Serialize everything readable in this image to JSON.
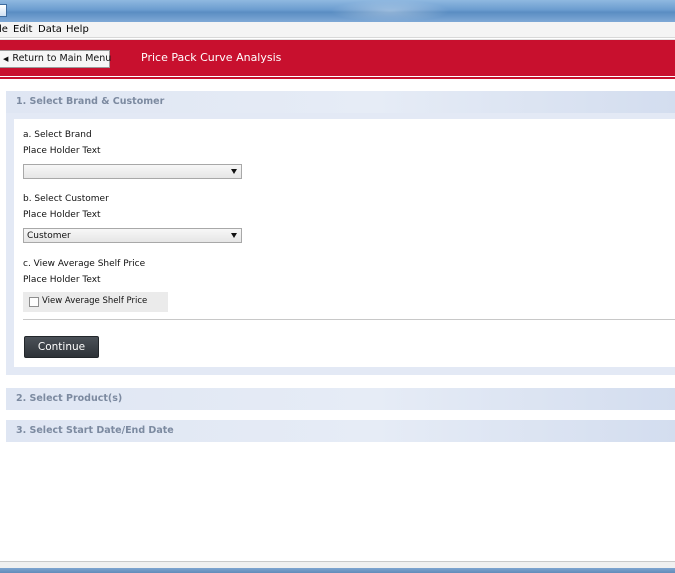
{
  "window": {
    "title": ""
  },
  "menu": {
    "items": [
      {
        "label": "le"
      },
      {
        "label": "Edit"
      },
      {
        "label": "Data"
      },
      {
        "label": "Help"
      }
    ]
  },
  "header": {
    "return_label": "Return to Main Menu",
    "title": "Price Pack Curve Analysis",
    "accent_color": "#c8102e"
  },
  "section1": {
    "title": "1. Select Brand & Customer",
    "brand": {
      "label": "a. Select Brand",
      "placeholder": "Place Holder Text",
      "value": ""
    },
    "customer": {
      "label": "b. Select Customer",
      "placeholder": "Place Holder Text",
      "value": "Customer"
    },
    "shelf_price": {
      "label": "c. View Average Shelf Price",
      "placeholder": "Place Holder Text",
      "checkbox_label": "View Average Shelf Price",
      "checked": false
    },
    "continue_label": "Continue"
  },
  "section2": {
    "title": "2. Select Product(s)"
  },
  "section3": {
    "title": "3. Select Start Date/End Date"
  },
  "icons": {
    "return": "triangle-left-icon",
    "dropdown": "chevron-down-icon",
    "app": "app-icon"
  }
}
